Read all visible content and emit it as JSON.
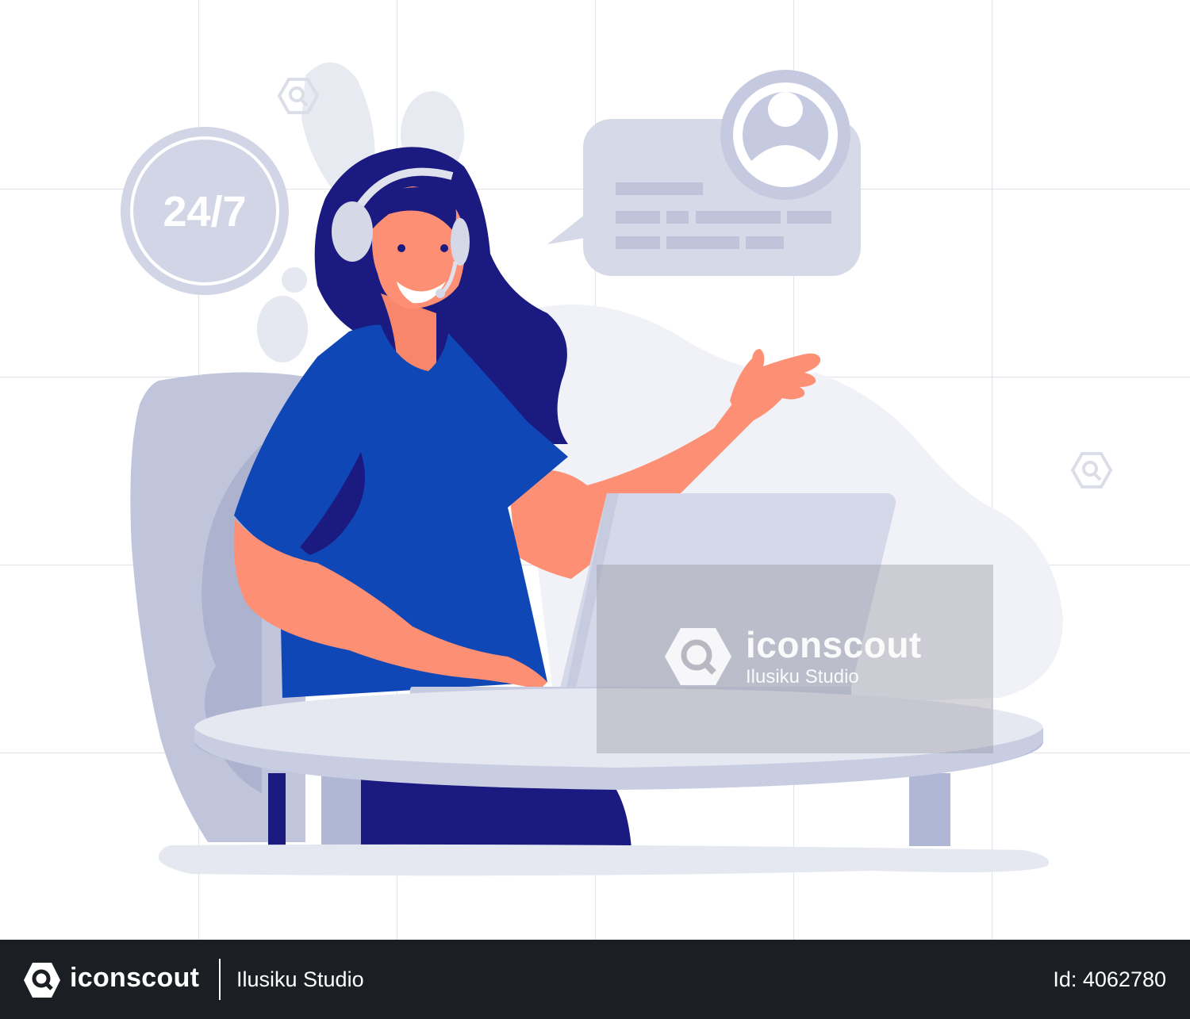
{
  "badge": {
    "text": "24/7"
  },
  "watermark": {
    "brand": "iconscout",
    "author": "Ilusiku Studio"
  },
  "footer": {
    "brand": "iconscout",
    "author": "Ilusiku Studio",
    "id": "Id: 4062780"
  },
  "colors": {
    "hair": "#1a1a80",
    "shirt": "#1047b6",
    "skin": "#fd9074",
    "chair": "#c0c5dc",
    "bubble": "#d6d9e8",
    "laptop": "#d5d8e8",
    "footer_bg": "#1b1e23"
  }
}
